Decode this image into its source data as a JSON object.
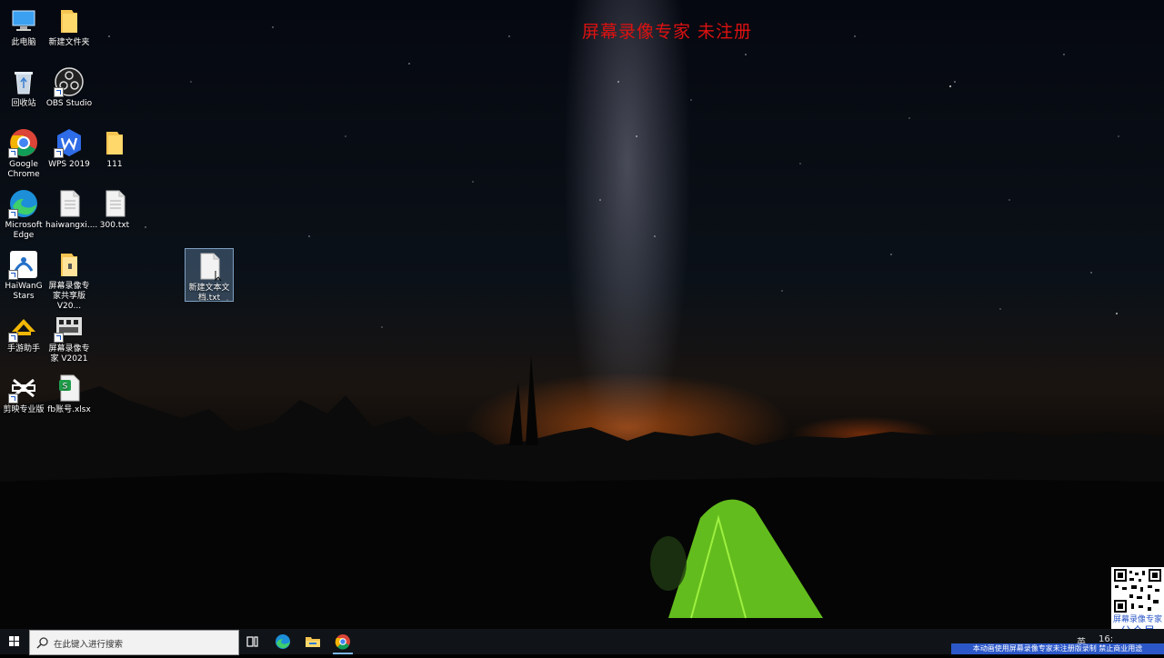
{
  "watermark": "屏幕录像专家  未注册",
  "desktop": {
    "icons": [
      {
        "name": "此电脑",
        "type": "pc"
      },
      {
        "name": "新建文件夹",
        "type": "folder"
      },
      {
        "name": "回收站",
        "type": "recycle"
      },
      {
        "name": "OBS Studio",
        "type": "obs"
      },
      {
        "name": "Google Chrome",
        "type": "chrome"
      },
      {
        "name": "WPS 2019",
        "type": "wps"
      },
      {
        "name": "111",
        "type": "folder"
      },
      {
        "name": "Microsoft Edge",
        "type": "edge"
      },
      {
        "name": "haiwangxi....",
        "type": "doc"
      },
      {
        "name": "300.txt",
        "type": "doc"
      },
      {
        "name": "HaiWanG Stars",
        "type": "haiwang"
      },
      {
        "name": "屏幕录像专家共享版 V20...",
        "type": "zipfolder"
      },
      {
        "name": "新建文本文档.txt",
        "type": "doc"
      },
      {
        "name": "手游助手",
        "type": "game"
      },
      {
        "name": "屏幕录像专家 V2021",
        "type": "recorder"
      },
      {
        "name": "剪映专业版",
        "type": "capcut"
      },
      {
        "name": "fb账号.xlsx",
        "type": "xlsx"
      }
    ]
  },
  "qr": {
    "caption1": "屏幕录像专家",
    "caption2": "公众号"
  },
  "taskbar": {
    "search_placeholder": "在此键入进行搜索",
    "tray_time": "16:",
    "tray_lang": "英"
  },
  "banner": "本动画使用屏幕录像专家未注册版录制  禁止商业用途",
  "colors": {
    "watermark": "#dd1111",
    "taskbar": "#101418",
    "banner": "#2b57c8",
    "selection": "#78a0c8"
  }
}
